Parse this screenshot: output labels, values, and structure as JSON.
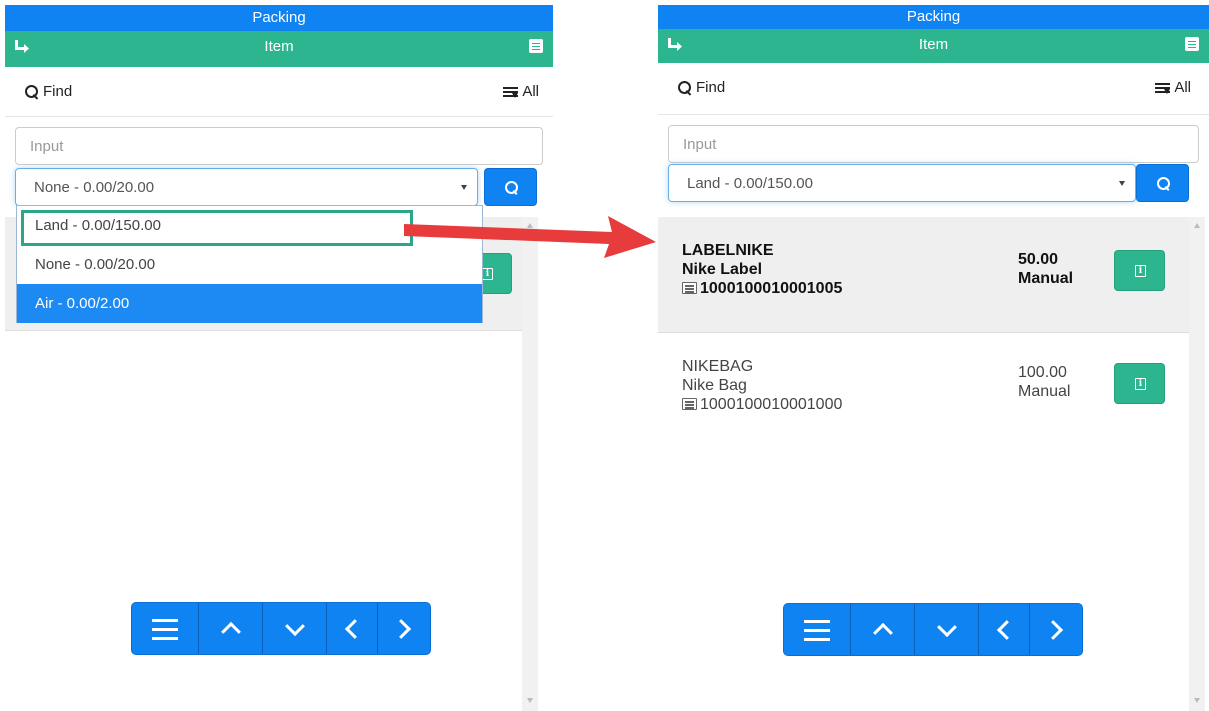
{
  "colors": {
    "primary": "#1083f3",
    "secondary": "#2cb58f",
    "arrow": "#e83b3b"
  },
  "left": {
    "title": "Packing",
    "subtitle": "Item",
    "find_label": "Find",
    "all_label": "All",
    "input_placeholder": "Input",
    "select_value": "None - 0.00/20.00",
    "dropdown_options": [
      {
        "label": "Land - 0.00/150.00"
      },
      {
        "label": "None - 0.00/20.00"
      },
      {
        "label": "Air - 0.00/2.00"
      }
    ]
  },
  "right": {
    "title": "Packing",
    "subtitle": "Item",
    "find_label": "Find",
    "all_label": "All",
    "input_placeholder": "Input",
    "select_value": "Land - 0.00/150.00",
    "items": [
      {
        "code": "LABELNIKE",
        "name": "Nike Label",
        "barcode": "1000100010001005",
        "qty": "50.00",
        "mode": "Manual"
      },
      {
        "code": "NIKEBAG",
        "name": "Nike Bag",
        "barcode": "1000100010001000",
        "qty": "100.00",
        "mode": "Manual"
      }
    ]
  },
  "icons": [
    "back-arrow-icon",
    "document-icon",
    "search-icon",
    "list-filter-icon",
    "barcode-icon",
    "info-icon",
    "menu-icon",
    "chevron-up-icon",
    "chevron-down-icon",
    "chevron-left-icon",
    "chevron-right-icon"
  ]
}
